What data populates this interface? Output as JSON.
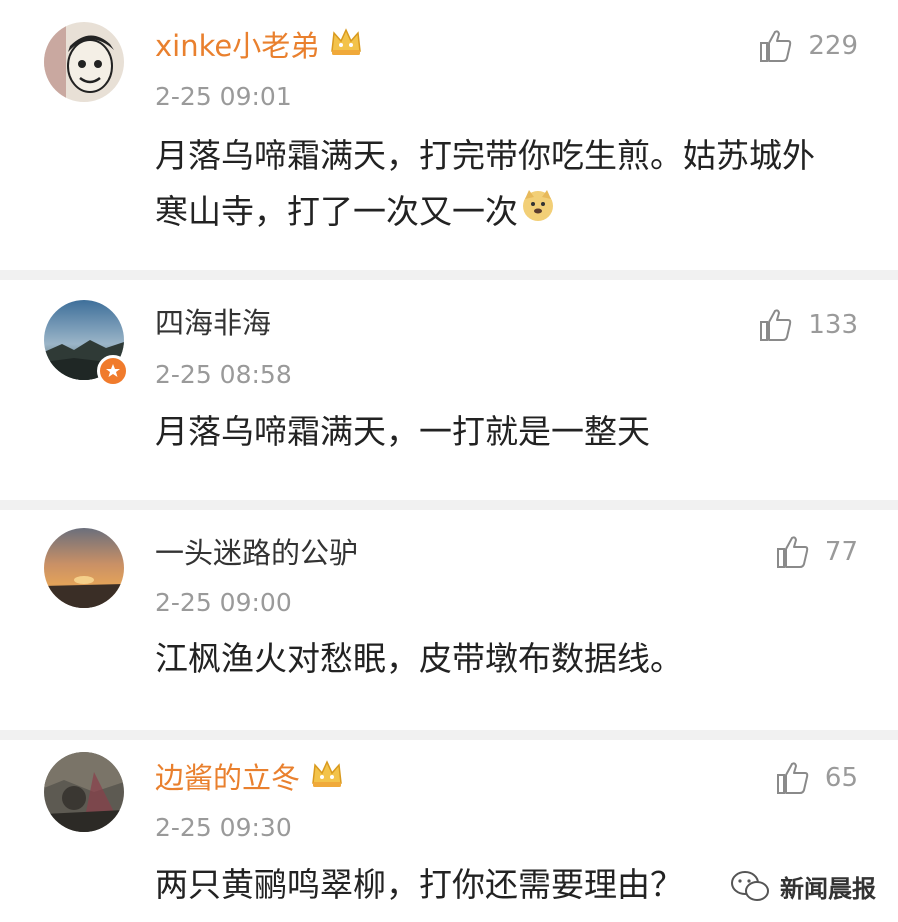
{
  "comments": [
    {
      "username": "xinke小老弟",
      "time": "2-25 09:01",
      "likes": "229",
      "text_line1": "月落乌啼霜满天，打完带你吃生煎。姑苏城外",
      "text_line2": "寒山寺，打了一次又一次",
      "vip": true,
      "avatar_icon": "cartoon-face-avatar"
    },
    {
      "username": "四海非海",
      "time": "2-25 08:58",
      "likes": "133",
      "text_line1": "月落乌啼霜满天，一打就是一整天",
      "vip": false,
      "avatar_icon": "landscape-avatar"
    },
    {
      "username": "一头迷路的公驴",
      "time": "2-25 09:00",
      "likes": "77",
      "text_line1": "江枫渔火对愁眠，皮带墩布数据线。",
      "vip": false,
      "avatar_icon": "sunset-avatar"
    },
    {
      "username": "边酱的立冬",
      "time": "2-25 09:30",
      "likes": "65",
      "text_line1": "两只黄鹂鸣翠柳，打你还需要理由？",
      "vip": true,
      "avatar_icon": "dark-photo-avatar"
    }
  ],
  "watermark": {
    "text": "新闻晨报",
    "icon": "wechat-icon"
  },
  "colors": {
    "vip_name": "#e9802e",
    "name": "#333333",
    "meta": "#9a9a9a",
    "text": "#222222",
    "separator": "#f1f1f1"
  }
}
